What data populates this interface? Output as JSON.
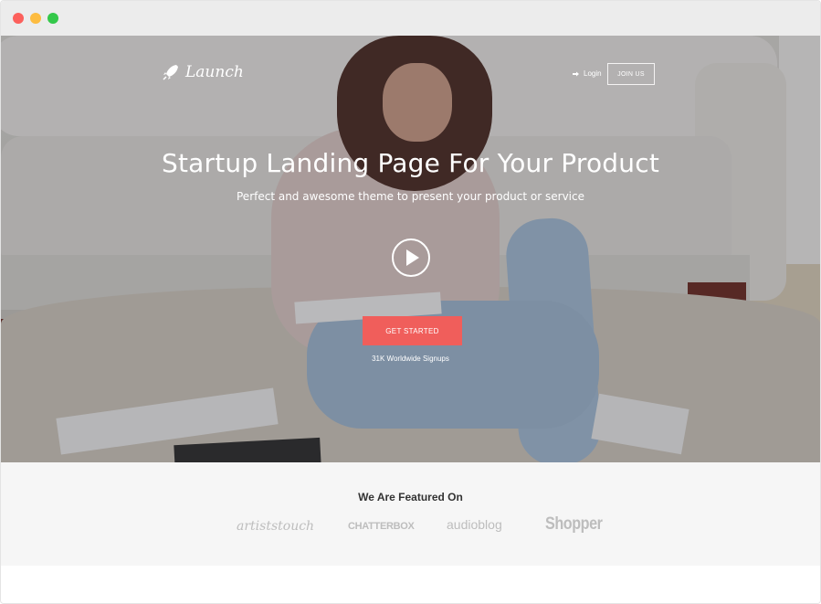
{
  "window": {
    "controls": [
      "close",
      "minimize",
      "maximize"
    ]
  },
  "header": {
    "logo_text": "Launch",
    "logo_icon": "rocket-icon",
    "login_label": "Login",
    "login_icon": "sign-in-icon",
    "join_label": "JOIN US"
  },
  "hero": {
    "headline": "Startup Landing Page For Your Product",
    "subheadline": "Perfect and awesome theme to present your product or service",
    "play_icon": "play-icon",
    "cta_label": "GET STARTED",
    "signups_text": "31K Worldwide Signups"
  },
  "featured": {
    "title": "We Are Featured On",
    "brands": [
      "artiststouch",
      "CHATTERBOX",
      "audioblog",
      "Shopper"
    ]
  },
  "colors": {
    "accent": "#f05e5b",
    "window_red": "#fc605c",
    "window_yellow": "#fdbc40",
    "window_green": "#34c84a"
  }
}
